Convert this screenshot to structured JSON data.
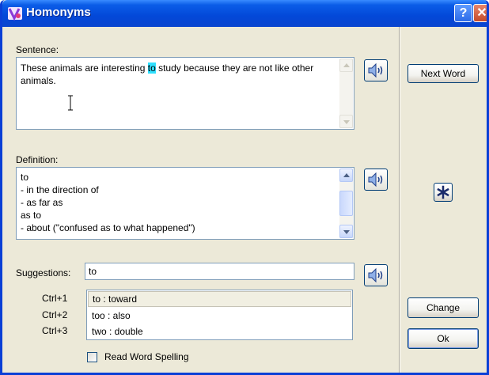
{
  "window": {
    "title": "Homonyms"
  },
  "sentence": {
    "label": "Sentence:",
    "text_before": "These animals are interesting ",
    "highlight": "to",
    "text_after": " study because they are not like other animals."
  },
  "definition": {
    "label": "Definition:",
    "text": "to\n- in the direction of\n- as far as\nas to\n- about (\"confused as to what happened\")"
  },
  "suggestions": {
    "label": "Suggestions:",
    "value": "to",
    "items": [
      {
        "shortcut": "Ctrl+1",
        "text": "to : toward",
        "selected": true
      },
      {
        "shortcut": "Ctrl+2",
        "text": "too : also",
        "selected": false
      },
      {
        "shortcut": "Ctrl+3",
        "text": "two : double",
        "selected": false
      }
    ]
  },
  "checkbox": {
    "label": "Read Word Spelling",
    "checked": false
  },
  "buttons": {
    "next_word": "Next Word",
    "change": "Change",
    "ok": "Ok"
  },
  "icons": {
    "app": "homonyms-app-icon",
    "speaker": "speaker-icon",
    "asterisk": "asterisk-icon",
    "help": "help-icon",
    "close": "close-icon"
  },
  "colors": {
    "titlebar": "#0348d8",
    "highlight": "#30e0ff",
    "close": "#c44b2a"
  }
}
